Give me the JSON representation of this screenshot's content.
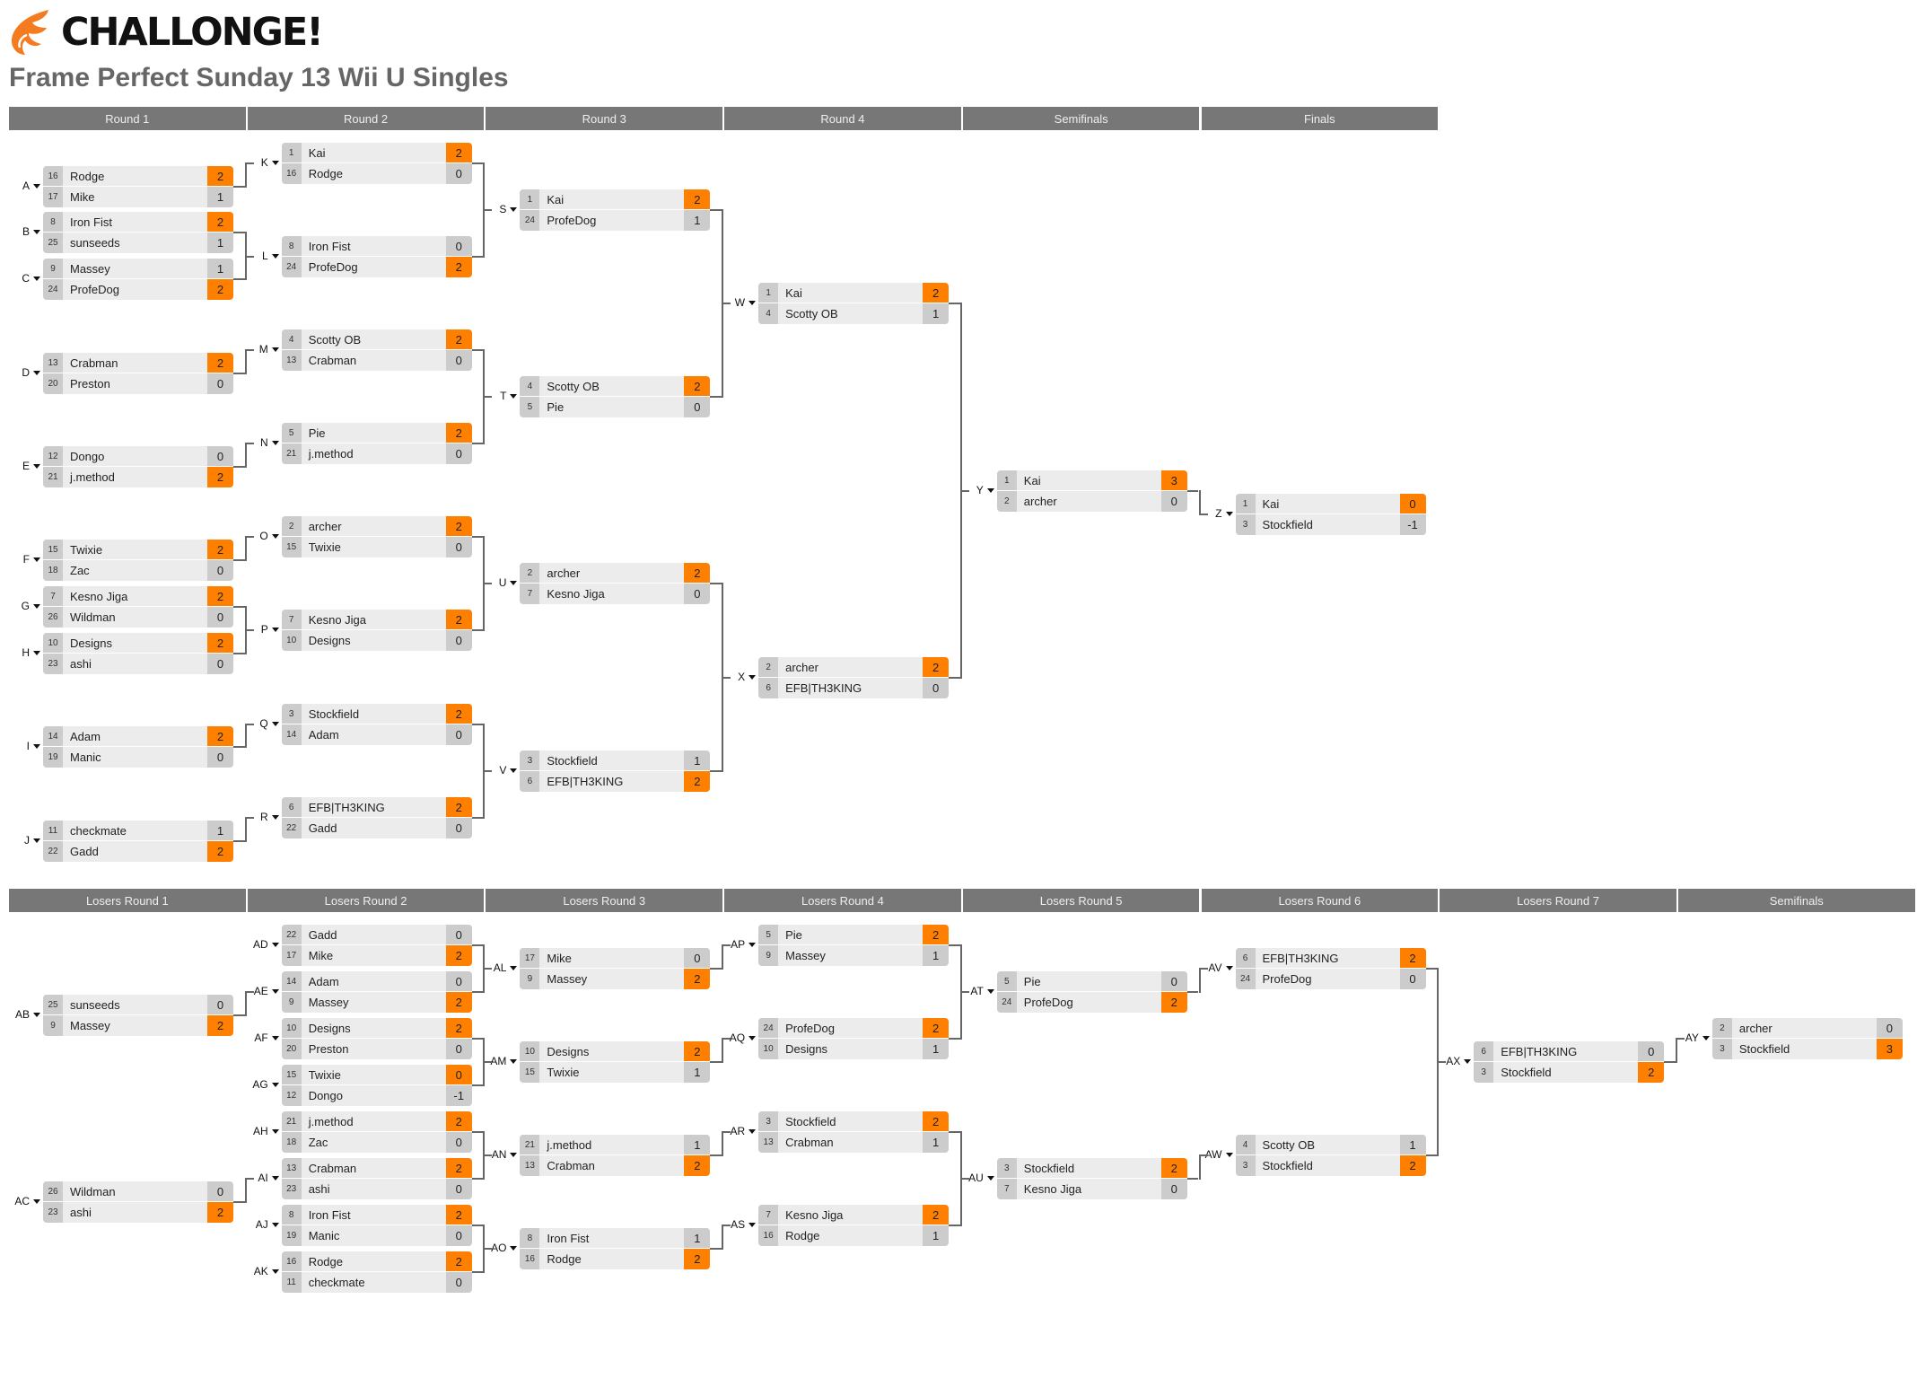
{
  "brand": {
    "name": "CHALLONGE!",
    "logo_icon": "challonge-flame-icon",
    "accent": "#ff7f00"
  },
  "tournament": {
    "title": "Frame Perfect Sunday 13 Wii U Singles"
  },
  "colors": {
    "header_bg": "#777777",
    "winner_score": "#ff7f00",
    "score_bg": "#cccccc",
    "row_bg": "#ececec",
    "connector": "#666666"
  },
  "winners": {
    "rounds": [
      "Round 1",
      "Round 2",
      "Round 3",
      "Round 4",
      "Semifinals",
      "Finals"
    ],
    "matches": [
      {
        "id": "A",
        "round": 0,
        "p": [
          [
            "16",
            "Rodge",
            "2"
          ],
          [
            "17",
            "Mike",
            "1"
          ]
        ],
        "w": 0
      },
      {
        "id": "B",
        "round": 0,
        "p": [
          [
            "8",
            "Iron Fist",
            "2"
          ],
          [
            "25",
            "sunseeds",
            "1"
          ]
        ],
        "w": 0
      },
      {
        "id": "C",
        "round": 0,
        "p": [
          [
            "9",
            "Massey",
            "1"
          ],
          [
            "24",
            "ProfeDog",
            "2"
          ]
        ],
        "w": 1
      },
      {
        "id": "D",
        "round": 0,
        "p": [
          [
            "13",
            "Crabman",
            "2"
          ],
          [
            "20",
            "Preston",
            "0"
          ]
        ],
        "w": 0
      },
      {
        "id": "E",
        "round": 0,
        "p": [
          [
            "12",
            "Dongo",
            "0"
          ],
          [
            "21",
            "j.method",
            "2"
          ]
        ],
        "w": 1
      },
      {
        "id": "F",
        "round": 0,
        "p": [
          [
            "15",
            "Twixie",
            "2"
          ],
          [
            "18",
            "Zac",
            "0"
          ]
        ],
        "w": 0
      },
      {
        "id": "G",
        "round": 0,
        "p": [
          [
            "7",
            "Kesno Jiga",
            "2"
          ],
          [
            "26",
            "Wildman",
            "0"
          ]
        ],
        "w": 0
      },
      {
        "id": "H",
        "round": 0,
        "p": [
          [
            "10",
            "Designs",
            "2"
          ],
          [
            "23",
            "ashi",
            "0"
          ]
        ],
        "w": 0
      },
      {
        "id": "I",
        "round": 0,
        "p": [
          [
            "14",
            "Adam",
            "2"
          ],
          [
            "19",
            "Manic",
            "0"
          ]
        ],
        "w": 0
      },
      {
        "id": "J",
        "round": 0,
        "p": [
          [
            "11",
            "checkmate",
            "1"
          ],
          [
            "22",
            "Gadd",
            "2"
          ]
        ],
        "w": 1
      },
      {
        "id": "K",
        "round": 1,
        "p": [
          [
            "1",
            "Kai",
            "2"
          ],
          [
            "16",
            "Rodge",
            "0"
          ]
        ],
        "w": 0
      },
      {
        "id": "L",
        "round": 1,
        "p": [
          [
            "8",
            "Iron Fist",
            "0"
          ],
          [
            "24",
            "ProfeDog",
            "2"
          ]
        ],
        "w": 1
      },
      {
        "id": "M",
        "round": 1,
        "p": [
          [
            "4",
            "Scotty OB",
            "2"
          ],
          [
            "13",
            "Crabman",
            "0"
          ]
        ],
        "w": 0
      },
      {
        "id": "N",
        "round": 1,
        "p": [
          [
            "5",
            "Pie",
            "2"
          ],
          [
            "21",
            "j.method",
            "0"
          ]
        ],
        "w": 0
      },
      {
        "id": "O",
        "round": 1,
        "p": [
          [
            "2",
            "archer",
            "2"
          ],
          [
            "15",
            "Twixie",
            "0"
          ]
        ],
        "w": 0
      },
      {
        "id": "P",
        "round": 1,
        "p": [
          [
            "7",
            "Kesno Jiga",
            "2"
          ],
          [
            "10",
            "Designs",
            "0"
          ]
        ],
        "w": 0
      },
      {
        "id": "Q",
        "round": 1,
        "p": [
          [
            "3",
            "Stockfield",
            "2"
          ],
          [
            "14",
            "Adam",
            "0"
          ]
        ],
        "w": 0
      },
      {
        "id": "R",
        "round": 1,
        "p": [
          [
            "6",
            "EFB|TH3KING",
            "2"
          ],
          [
            "22",
            "Gadd",
            "0"
          ]
        ],
        "w": 0
      },
      {
        "id": "S",
        "round": 2,
        "p": [
          [
            "1",
            "Kai",
            "2"
          ],
          [
            "24",
            "ProfeDog",
            "1"
          ]
        ],
        "w": 0
      },
      {
        "id": "T",
        "round": 2,
        "p": [
          [
            "4",
            "Scotty OB",
            "2"
          ],
          [
            "5",
            "Pie",
            "0"
          ]
        ],
        "w": 0
      },
      {
        "id": "U",
        "round": 2,
        "p": [
          [
            "2",
            "archer",
            "2"
          ],
          [
            "7",
            "Kesno Jiga",
            "0"
          ]
        ],
        "w": 0
      },
      {
        "id": "V",
        "round": 2,
        "p": [
          [
            "3",
            "Stockfield",
            "1"
          ],
          [
            "6",
            "EFB|TH3KING",
            "2"
          ]
        ],
        "w": 1
      },
      {
        "id": "W",
        "round": 3,
        "p": [
          [
            "1",
            "Kai",
            "2"
          ],
          [
            "4",
            "Scotty OB",
            "1"
          ]
        ],
        "w": 0
      },
      {
        "id": "X",
        "round": 3,
        "p": [
          [
            "2",
            "archer",
            "2"
          ],
          [
            "6",
            "EFB|TH3KING",
            "0"
          ]
        ],
        "w": 0
      },
      {
        "id": "Y",
        "round": 4,
        "p": [
          [
            "1",
            "Kai",
            "3"
          ],
          [
            "2",
            "archer",
            "0"
          ]
        ],
        "w": 0
      },
      {
        "id": "Z",
        "round": 5,
        "p": [
          [
            "1",
            "Kai",
            "0"
          ],
          [
            "3",
            "Stockfield",
            "-1"
          ]
        ],
        "w": 0
      }
    ]
  },
  "losers": {
    "rounds": [
      "Losers Round 1",
      "Losers Round 2",
      "Losers Round 3",
      "Losers Round 4",
      "Losers Round 5",
      "Losers Round 6",
      "Losers Round 7",
      "Semifinals"
    ],
    "matches": [
      {
        "id": "AB",
        "round": 0,
        "p": [
          [
            "25",
            "sunseeds",
            "0"
          ],
          [
            "9",
            "Massey",
            "2"
          ]
        ],
        "w": 1
      },
      {
        "id": "AC",
        "round": 0,
        "p": [
          [
            "26",
            "Wildman",
            "0"
          ],
          [
            "23",
            "ashi",
            "2"
          ]
        ],
        "w": 1
      },
      {
        "id": "AD",
        "round": 1,
        "p": [
          [
            "22",
            "Gadd",
            "0"
          ],
          [
            "17",
            "Mike",
            "2"
          ]
        ],
        "w": 1
      },
      {
        "id": "AE",
        "round": 1,
        "p": [
          [
            "14",
            "Adam",
            "0"
          ],
          [
            "9",
            "Massey",
            "2"
          ]
        ],
        "w": 1
      },
      {
        "id": "AF",
        "round": 1,
        "p": [
          [
            "10",
            "Designs",
            "2"
          ],
          [
            "20",
            "Preston",
            "0"
          ]
        ],
        "w": 0
      },
      {
        "id": "AG",
        "round": 1,
        "p": [
          [
            "15",
            "Twixie",
            "0"
          ],
          [
            "12",
            "Dongo",
            "-1"
          ]
        ],
        "w": 0
      },
      {
        "id": "AH",
        "round": 1,
        "p": [
          [
            "21",
            "j.method",
            "2"
          ],
          [
            "18",
            "Zac",
            "0"
          ]
        ],
        "w": 0
      },
      {
        "id": "AI",
        "round": 1,
        "p": [
          [
            "13",
            "Crabman",
            "2"
          ],
          [
            "23",
            "ashi",
            "0"
          ]
        ],
        "w": 0
      },
      {
        "id": "AJ",
        "round": 1,
        "p": [
          [
            "8",
            "Iron Fist",
            "2"
          ],
          [
            "19",
            "Manic",
            "0"
          ]
        ],
        "w": 0
      },
      {
        "id": "AK",
        "round": 1,
        "p": [
          [
            "16",
            "Rodge",
            "2"
          ],
          [
            "11",
            "checkmate",
            "0"
          ]
        ],
        "w": 0
      },
      {
        "id": "AL",
        "round": 2,
        "p": [
          [
            "17",
            "Mike",
            "0"
          ],
          [
            "9",
            "Massey",
            "2"
          ]
        ],
        "w": 1
      },
      {
        "id": "AM",
        "round": 2,
        "p": [
          [
            "10",
            "Designs",
            "2"
          ],
          [
            "15",
            "Twixie",
            "1"
          ]
        ],
        "w": 0
      },
      {
        "id": "AN",
        "round": 2,
        "p": [
          [
            "21",
            "j.method",
            "1"
          ],
          [
            "13",
            "Crabman",
            "2"
          ]
        ],
        "w": 1
      },
      {
        "id": "AO",
        "round": 2,
        "p": [
          [
            "8",
            "Iron Fist",
            "1"
          ],
          [
            "16",
            "Rodge",
            "2"
          ]
        ],
        "w": 1
      },
      {
        "id": "AP",
        "round": 3,
        "p": [
          [
            "5",
            "Pie",
            "2"
          ],
          [
            "9",
            "Massey",
            "1"
          ]
        ],
        "w": 0
      },
      {
        "id": "AQ",
        "round": 3,
        "p": [
          [
            "24",
            "ProfeDog",
            "2"
          ],
          [
            "10",
            "Designs",
            "1"
          ]
        ],
        "w": 0
      },
      {
        "id": "AR",
        "round": 3,
        "p": [
          [
            "3",
            "Stockfield",
            "2"
          ],
          [
            "13",
            "Crabman",
            "1"
          ]
        ],
        "w": 0
      },
      {
        "id": "AS",
        "round": 3,
        "p": [
          [
            "7",
            "Kesno Jiga",
            "2"
          ],
          [
            "16",
            "Rodge",
            "1"
          ]
        ],
        "w": 0
      },
      {
        "id": "AT",
        "round": 4,
        "p": [
          [
            "5",
            "Pie",
            "0"
          ],
          [
            "24",
            "ProfeDog",
            "2"
          ]
        ],
        "w": 1
      },
      {
        "id": "AU",
        "round": 4,
        "p": [
          [
            "3",
            "Stockfield",
            "2"
          ],
          [
            "7",
            "Kesno Jiga",
            "0"
          ]
        ],
        "w": 0
      },
      {
        "id": "AV",
        "round": 5,
        "p": [
          [
            "6",
            "EFB|TH3KING",
            "2"
          ],
          [
            "24",
            "ProfeDog",
            "0"
          ]
        ],
        "w": 0
      },
      {
        "id": "AW",
        "round": 5,
        "p": [
          [
            "4",
            "Scotty OB",
            "1"
          ],
          [
            "3",
            "Stockfield",
            "2"
          ]
        ],
        "w": 1
      },
      {
        "id": "AX",
        "round": 6,
        "p": [
          [
            "6",
            "EFB|TH3KING",
            "0"
          ],
          [
            "3",
            "Stockfield",
            "2"
          ]
        ],
        "w": 1
      },
      {
        "id": "AY",
        "round": 7,
        "p": [
          [
            "2",
            "archer",
            "0"
          ],
          [
            "3",
            "Stockfield",
            "3"
          ]
        ],
        "w": 1
      }
    ]
  }
}
